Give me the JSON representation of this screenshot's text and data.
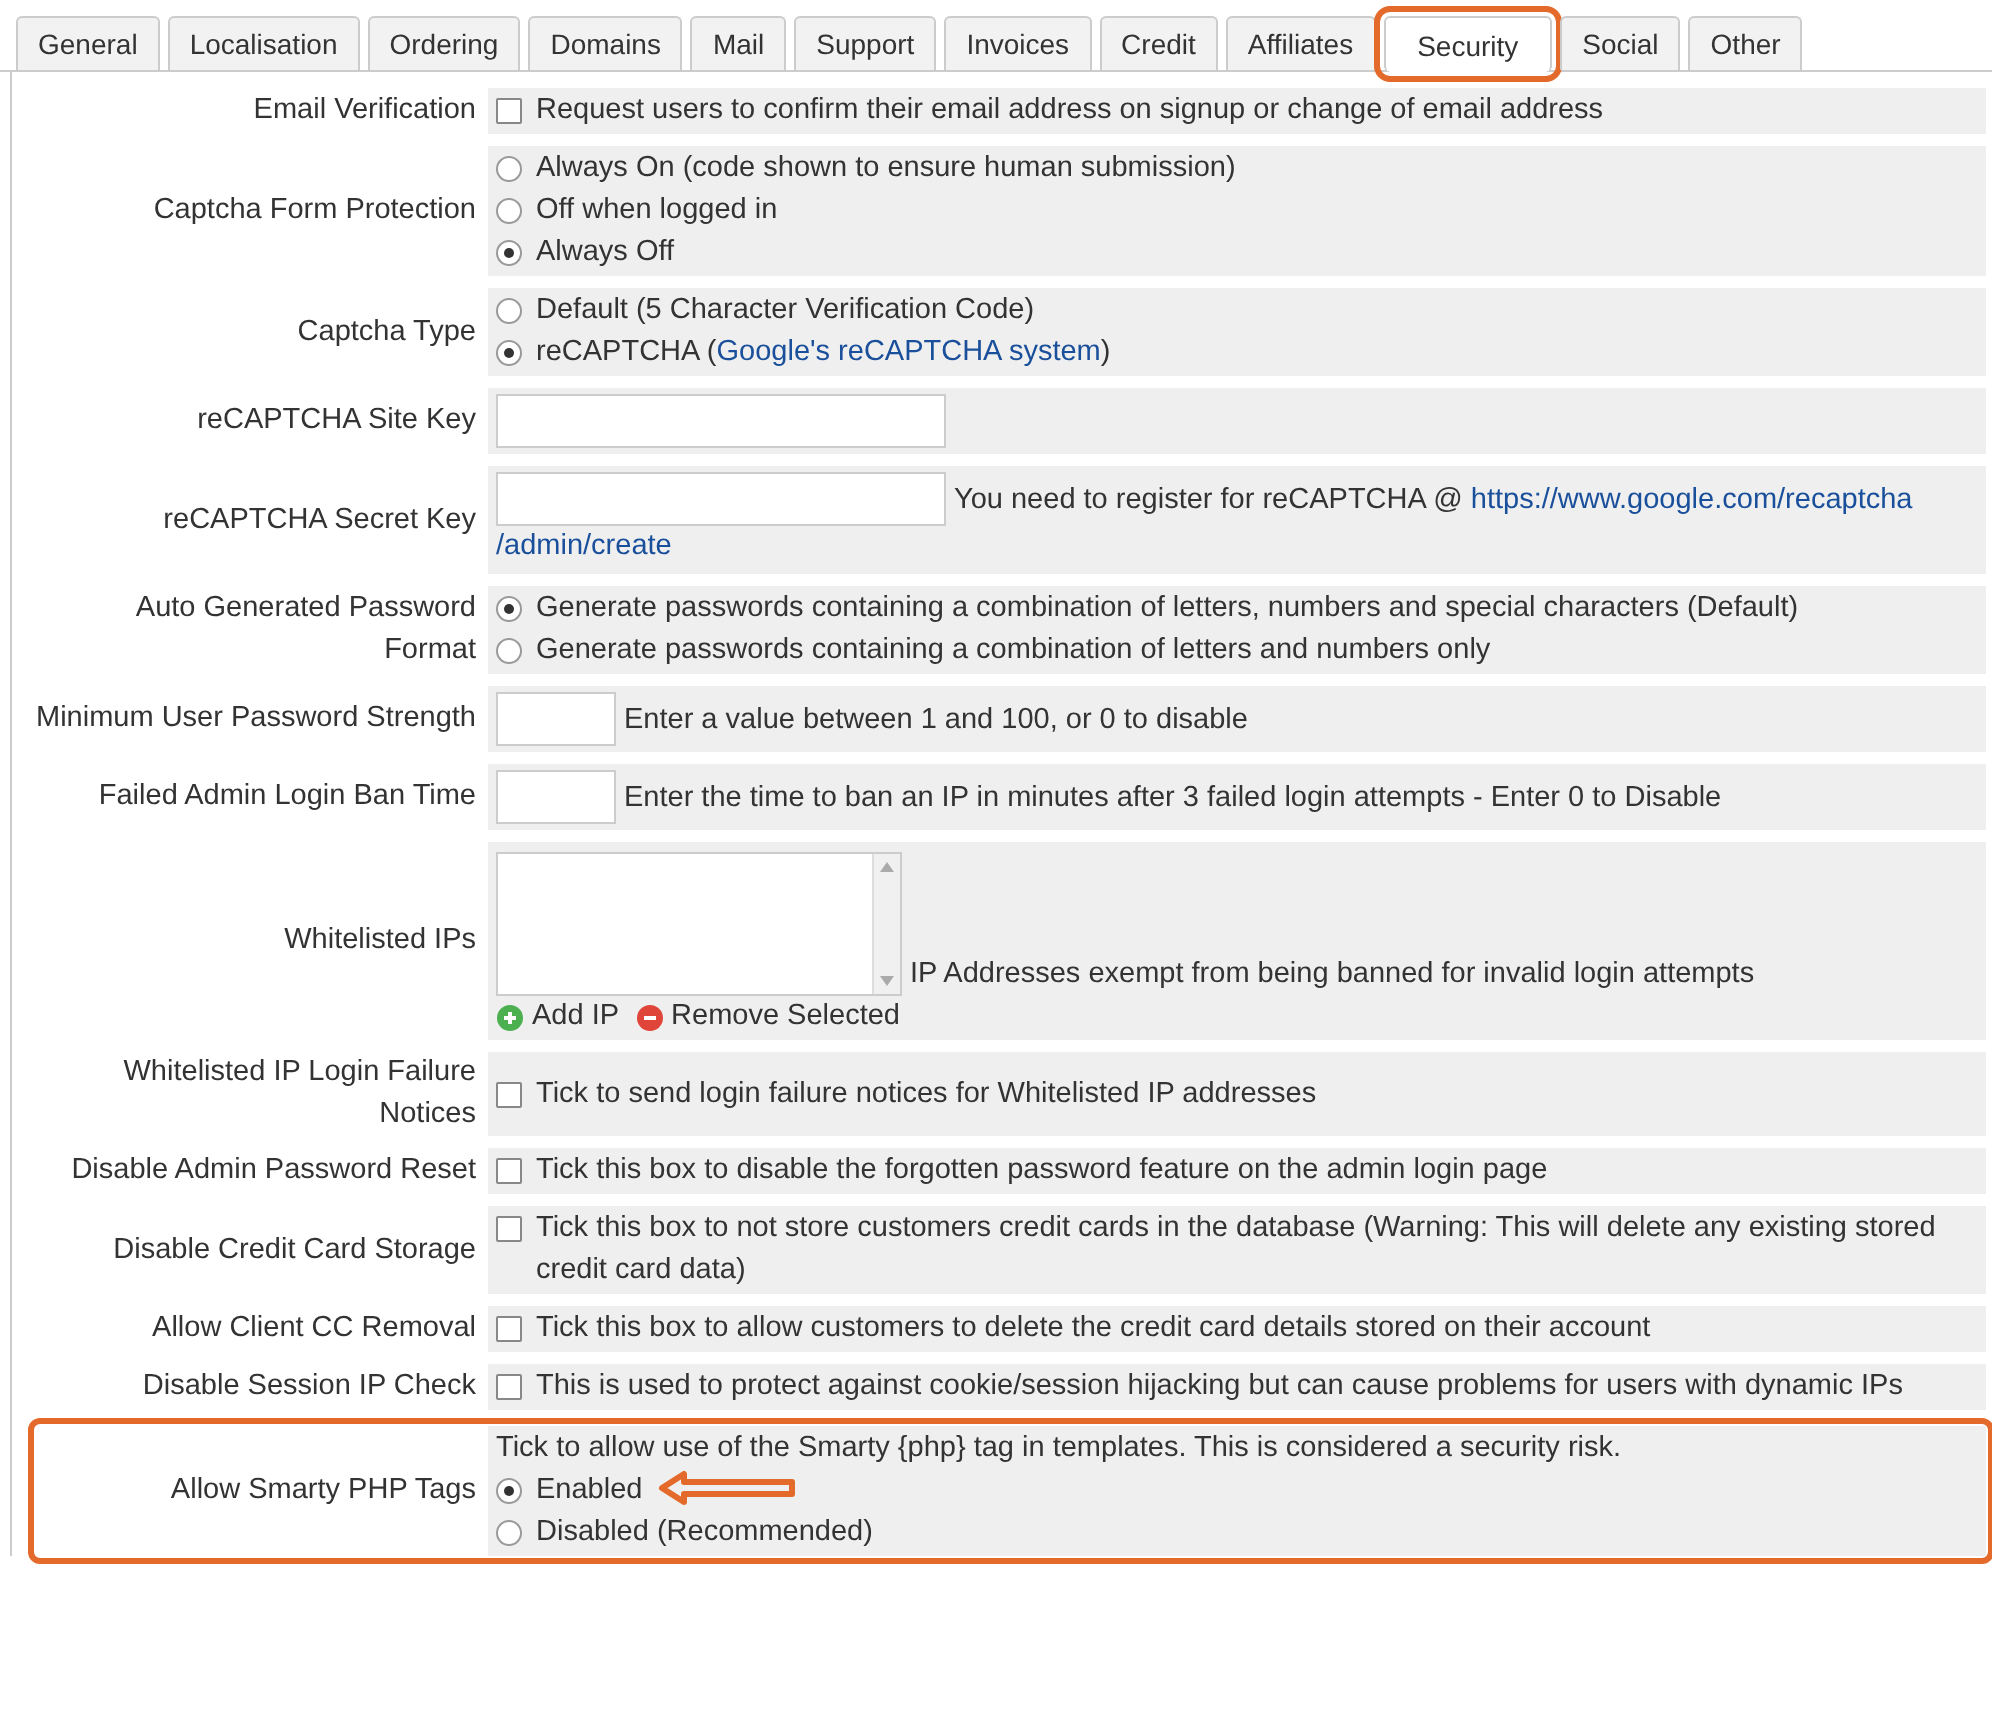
{
  "tabs": [
    {
      "label": "General",
      "selected": false,
      "highlighted": false
    },
    {
      "label": "Localisation",
      "selected": false,
      "highlighted": false
    },
    {
      "label": "Ordering",
      "selected": false,
      "highlighted": false
    },
    {
      "label": "Domains",
      "selected": false,
      "highlighted": false
    },
    {
      "label": "Mail",
      "selected": false,
      "highlighted": false
    },
    {
      "label": "Support",
      "selected": false,
      "highlighted": false
    },
    {
      "label": "Invoices",
      "selected": false,
      "highlighted": false
    },
    {
      "label": "Credit",
      "selected": false,
      "highlighted": false
    },
    {
      "label": "Affiliates",
      "selected": false,
      "highlighted": false
    },
    {
      "label": "Security",
      "selected": true,
      "highlighted": true
    },
    {
      "label": "Social",
      "selected": false,
      "highlighted": false
    },
    {
      "label": "Other",
      "selected": false,
      "highlighted": false
    }
  ],
  "settings": [
    {
      "label": "Email Verification",
      "kind": "checkbox",
      "highlighted": false,
      "checked": false,
      "text": "Request users to confirm their email address on signup or change of email address"
    },
    {
      "label": "Captcha Form Protection",
      "kind": "radios",
      "highlighted": false,
      "options": [
        {
          "text": "Always On (code shown to ensure human submission)",
          "selected": false,
          "annotated": false
        },
        {
          "text": "Off when logged in",
          "selected": false,
          "annotated": false
        },
        {
          "text": "Always Off",
          "selected": true,
          "annotated": false
        }
      ]
    },
    {
      "label": "Captcha Type",
      "kind": "radios",
      "highlighted": false,
      "options": [
        {
          "text": "Default (5 Character Verification Code)",
          "selected": false,
          "annotated": false
        },
        {
          "text": "reCAPTCHA (",
          "link": "Google's reCAPTCHA system",
          "after": ")",
          "selected": true,
          "annotated": false
        }
      ]
    },
    {
      "label": "reCAPTCHA Site Key",
      "kind": "text-input",
      "highlighted": false
    },
    {
      "label": "reCAPTCHA Secret Key",
      "kind": "text-input",
      "highlighted": false,
      "note": "You need to register for reCAPTCHA @ ",
      "link": "https://www.google.com/recaptcha",
      "link_rest": "/admin/create"
    },
    {
      "label": "Auto Generated Password Format",
      "kind": "radios",
      "highlighted": false,
      "options": [
        {
          "text": "Generate passwords containing a combination of letters, numbers and special characters (Default)",
          "selected": true,
          "annotated": false
        },
        {
          "text": "Generate passwords containing a combination of letters and numbers only",
          "selected": false,
          "annotated": false
        }
      ]
    },
    {
      "label": "Minimum User Password Strength",
      "kind": "number-input",
      "highlighted": false,
      "note": "Enter a value between 1 and 100, or 0 to disable"
    },
    {
      "label": "Failed Admin Login Ban Time",
      "kind": "number-input",
      "highlighted": false,
      "note": "Enter the time to ban an IP in minutes after 3 failed login attempts - Enter 0 to Disable"
    },
    {
      "label": "Whitelisted IPs",
      "kind": "list",
      "highlighted": false,
      "note": "IP Addresses exempt from being banned for invalid login attempts",
      "actions": [
        {
          "text": "Add IP",
          "kind": "add"
        },
        {
          "text": "Remove Selected",
          "kind": "remove"
        }
      ]
    },
    {
      "label": "Whitelisted IP Login Failure Notices",
      "kind": "checkbox",
      "highlighted": false,
      "checked": false,
      "text": "Tick to send login failure notices for Whitelisted IP addresses"
    },
    {
      "label": "Disable Admin Password Reset",
      "kind": "checkbox",
      "highlighted": false,
      "checked": false,
      "text": "Tick this box to disable the forgotten password feature on the admin login page"
    },
    {
      "label": "Disable Credit Card Storage",
      "kind": "checkbox",
      "highlighted": false,
      "checked": false,
      "text": "Tick this box to not store customers credit cards in the database (Warning: This will delete any existing stored credit card data)"
    },
    {
      "label": "Allow Client CC Removal",
      "kind": "checkbox",
      "highlighted": false,
      "checked": false,
      "text": "Tick this box to allow customers to delete the credit card details stored on their account"
    },
    {
      "label": "Disable Session IP Check",
      "kind": "checkbox",
      "highlighted": false,
      "checked": false,
      "text": "This is used to protect against cookie/session hijacking but can cause problems for users with dynamic IPs"
    },
    {
      "label": "Allow Smarty PHP Tags",
      "kind": "radios",
      "highlighted": true,
      "intro": "Tick to allow use of the Smarty {php} tag in templates. This is considered a security risk.",
      "options": [
        {
          "text": "Enabled",
          "selected": true,
          "annotated": true
        },
        {
          "text": "Disabled (Recommended)",
          "selected": false,
          "annotated": false
        }
      ]
    }
  ]
}
